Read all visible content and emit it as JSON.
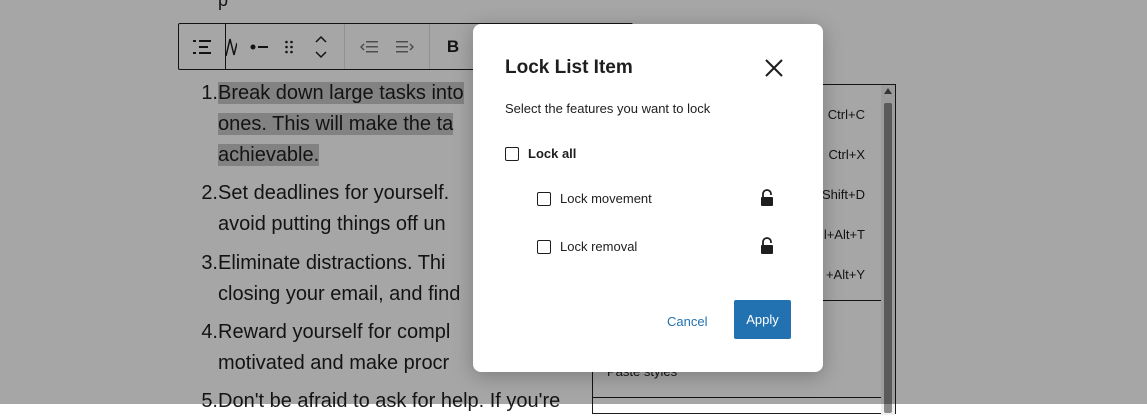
{
  "editor": {
    "top_fragment": "p",
    "toolbar": {
      "parent_icon": "list-view-icon",
      "bullet_icon": "unordered-list-icon",
      "drag_icon": "drag-handle-icon",
      "move_icon": "move-up-down-icon",
      "outdent_icon": "outdent-icon",
      "indent_icon": "indent-icon",
      "bold_label": "B"
    },
    "list_items": [
      {
        "num": "1.",
        "lines": [
          "Break down large tasks into",
          "ones. This will make the ta",
          "achievable."
        ]
      },
      {
        "num": "2.",
        "lines": [
          "Set deadlines for yourself.",
          "avoid putting things off un"
        ]
      },
      {
        "num": "3.",
        "lines": [
          "Eliminate distractions. Thi",
          "closing your email, and find"
        ]
      },
      {
        "num": "4.",
        "lines": [
          "Reward yourself for compl",
          "motivated and make procr"
        ]
      },
      {
        "num": "5.",
        "lines": [
          "Don't be afraid to ask for help. If you're"
        ]
      }
    ],
    "menu": {
      "shortcuts": [
        "Ctrl+C",
        "Ctrl+X",
        "Shift+D",
        "l+Alt+T",
        "+Alt+Y"
      ],
      "paste_styles": "Paste styles"
    }
  },
  "modal": {
    "title": "Lock List Item",
    "close_icon": "close-icon",
    "description": "Select the features you want to lock",
    "lock_all_label": "Lock all",
    "options": [
      {
        "label": "Lock movement",
        "icon": "unlock-icon"
      },
      {
        "label": "Lock removal",
        "icon": "unlock-icon"
      }
    ],
    "cancel_label": "Cancel",
    "apply_label": "Apply",
    "accent_color": "#2271b1"
  }
}
